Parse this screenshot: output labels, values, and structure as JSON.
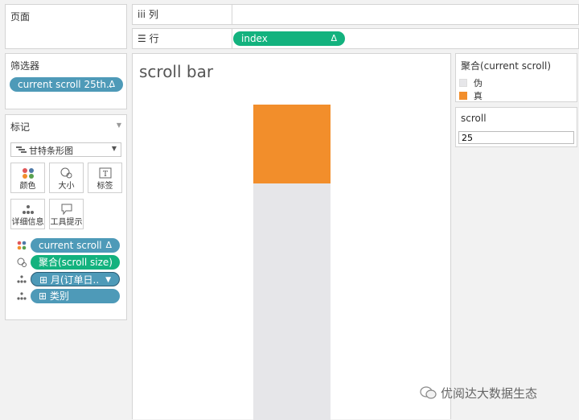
{
  "pages_panel": {
    "title": "页面"
  },
  "filters_panel": {
    "title": "筛选器",
    "filter_pill": "current scroll 25th..",
    "filter_delta": "Δ"
  },
  "marks_panel": {
    "title": "标记",
    "mark_type": "甘特条形图",
    "buttons": {
      "color": "颜色",
      "size": "大小",
      "label": "标签",
      "detail": "详细信息",
      "tooltip": "工具提示"
    },
    "fields": [
      {
        "label": "current scroll",
        "suffix": "Δ"
      },
      {
        "label": "聚合(scroll size)"
      },
      {
        "label": "⊞ 月(订单日..",
        "suffix": "▼"
      },
      {
        "label": "⊞ 类别"
      }
    ]
  },
  "columns_shelf": {
    "label": "iii 列"
  },
  "rows_shelf": {
    "label": "☰ 行",
    "pill": "index",
    "pill_delta": "Δ"
  },
  "view": {
    "title": "scroll bar",
    "chart_data": {
      "type": "bar",
      "title": "scroll bar",
      "total": 100,
      "series": [
        {
          "name": "真",
          "value": 25,
          "color": "#f28e2b"
        },
        {
          "name": "伪",
          "value": 75,
          "color": "#e6e6e9"
        }
      ]
    }
  },
  "legend": {
    "title": "聚合(current scroll)",
    "items": [
      {
        "label": "伪",
        "color": "#e6e6e9"
      },
      {
        "label": "真",
        "color": "#f28e2b"
      }
    ]
  },
  "parameter": {
    "title": "scroll",
    "value": "25"
  },
  "watermark": {
    "text": "优阅达大数据生态"
  }
}
